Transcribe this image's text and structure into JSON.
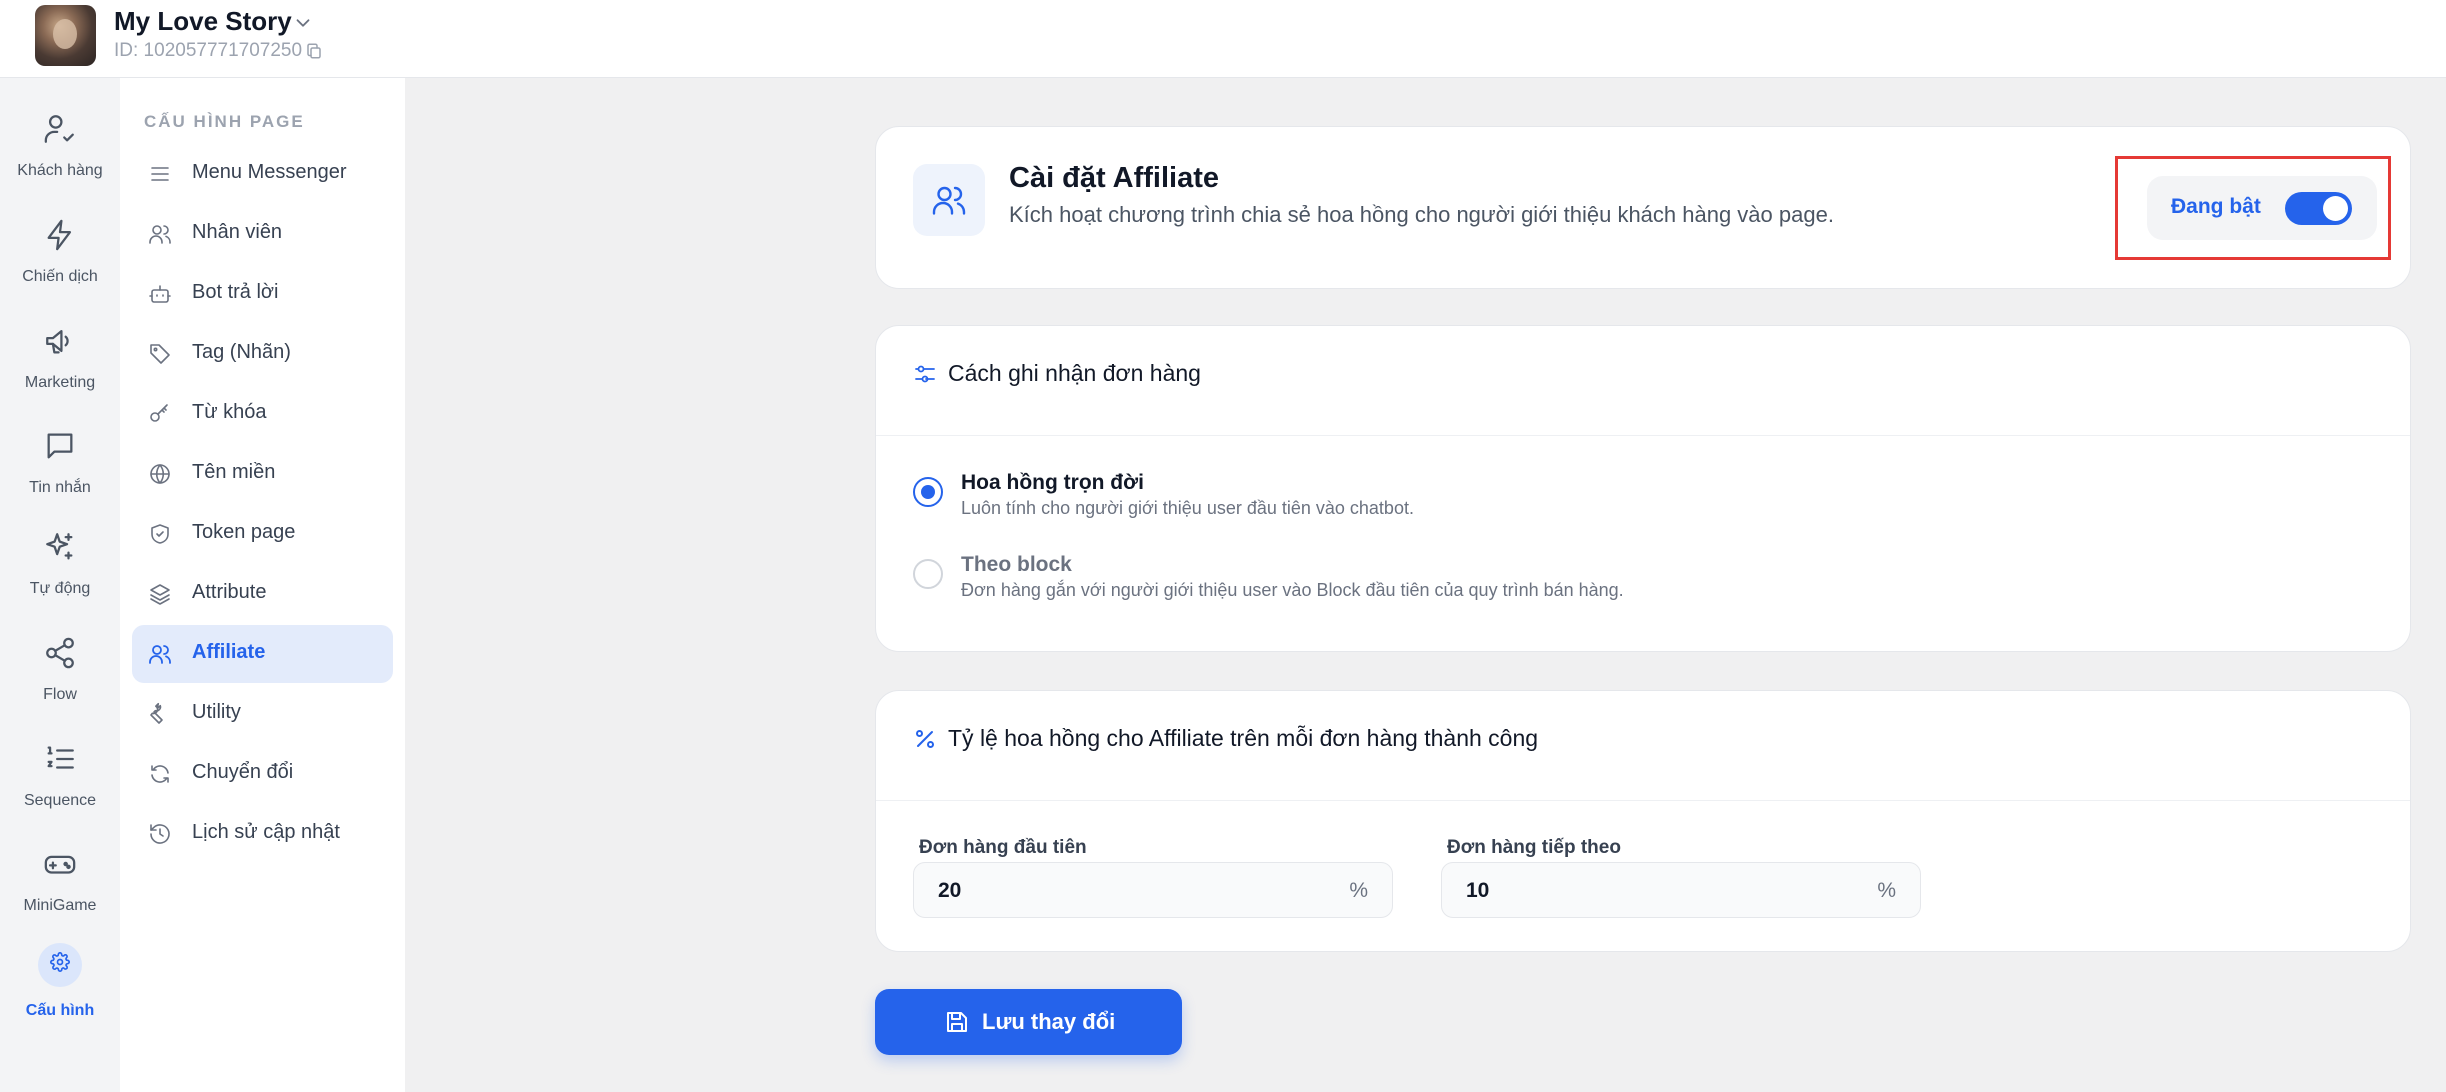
{
  "header": {
    "page_name": "My Love Story",
    "page_id": "ID: 102057771707250"
  },
  "rail": {
    "items": [
      {
        "label": "Khách hàng",
        "icon": "user-check-icon"
      },
      {
        "label": "Chiến dịch",
        "icon": "lightning-icon"
      },
      {
        "label": "Marketing",
        "icon": "megaphone-icon"
      },
      {
        "label": "Tin nhắn",
        "icon": "message-icon"
      },
      {
        "label": "Tự động",
        "icon": "sparkles-icon"
      },
      {
        "label": "Flow",
        "icon": "share-icon"
      },
      {
        "label": "Sequence",
        "icon": "list-ordered-icon"
      },
      {
        "label": "MiniGame",
        "icon": "gamepad-icon"
      },
      {
        "label": "Cấu hình",
        "icon": "gear-icon"
      }
    ],
    "active": "Cấu hình"
  },
  "subnav": {
    "heading": "CẤU HÌNH PAGE",
    "items": [
      {
        "label": "Menu Messenger",
        "icon": "menu-icon"
      },
      {
        "label": "Nhân viên",
        "icon": "users-icon"
      },
      {
        "label": "Bot trả lời",
        "icon": "bot-icon"
      },
      {
        "label": "Tag (Nhãn)",
        "icon": "tag-icon"
      },
      {
        "label": "Từ khóa",
        "icon": "key-icon"
      },
      {
        "label": "Tên miền",
        "icon": "globe-icon"
      },
      {
        "label": "Token page",
        "icon": "shield-icon"
      },
      {
        "label": "Attribute",
        "icon": "layers-icon"
      },
      {
        "label": "Affiliate",
        "icon": "users-icon"
      },
      {
        "label": "Utility",
        "icon": "wrench-icon"
      },
      {
        "label": "Chuyển đổi",
        "icon": "refresh-icon"
      },
      {
        "label": "Lịch sử cập nhật",
        "icon": "history-icon"
      }
    ],
    "active": "Affiliate"
  },
  "affiliate": {
    "title": "Cài đặt Affiliate",
    "description": "Kích hoạt chương trình chia sẻ hoa hồng cho người giới thiệu khách hàng vào page.",
    "toggle_label": "Đang bật",
    "enabled": true
  },
  "order_tracking": {
    "title": "Cách ghi nhận đơn hàng",
    "options": [
      {
        "title": "Hoa hồng trọn đời",
        "description": "Luôn tính cho người giới thiệu user đầu tiên vào chatbot.",
        "selected": true
      },
      {
        "title": "Theo block",
        "description": "Đơn hàng gắn với người giới thiệu user vào Block đầu tiên của quy trình bán hàng.",
        "selected": false
      }
    ]
  },
  "commission": {
    "title": "Tỷ lệ hoa hồng cho Affiliate trên mỗi đơn hàng thành công",
    "first_order_label": "Đơn hàng đầu tiên",
    "first_order_value": "20",
    "next_order_label": "Đơn hàng tiếp theo",
    "next_order_value": "10",
    "unit": "%"
  },
  "actions": {
    "save_label": "Lưu thay đổi"
  },
  "colors": {
    "accent": "#2563eb",
    "highlight_frame": "#e53935",
    "nav_active_bg": "#e3ebfb"
  }
}
